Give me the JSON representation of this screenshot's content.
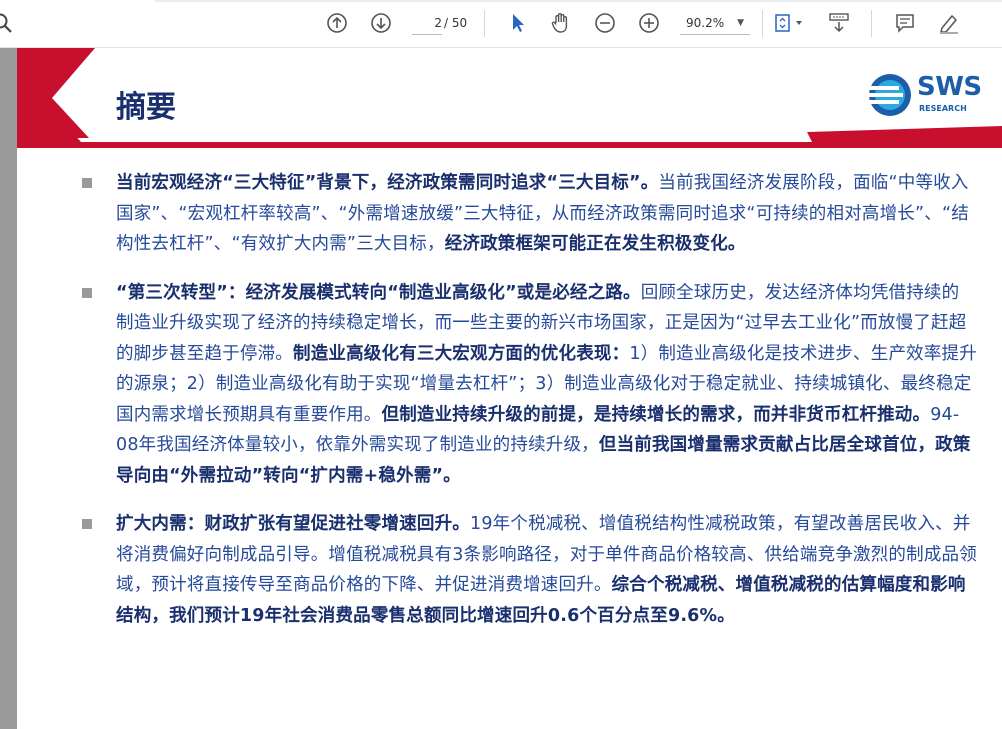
{
  "toolbar": {
    "page_current": "2",
    "page_total": "/ 50",
    "zoom": "90.2%",
    "icons": [
      "search-icon",
      "page-up-icon",
      "page-down-icon",
      "select-cursor-icon",
      "hand-tool-icon",
      "zoom-out-icon",
      "zoom-in-icon",
      "fit-page-icon",
      "scroll-mode-icon",
      "comment-icon",
      "highlight-pen-icon"
    ]
  },
  "document": {
    "title": "摘要",
    "logo_text": "SWS",
    "logo_subtext": "RESEARCH",
    "colors": {
      "accent_red": "#c8102e",
      "navy": "#1a2f6e",
      "body_blue": "#264a9a",
      "logo_blue": "#1c5fa8"
    },
    "paragraphs": [
      {
        "segments": [
          {
            "bold": true,
            "text": "当前宏观经济“三大特征”背景下，经济政策需同时追求“三大目标”。"
          },
          {
            "bold": false,
            "text": "当前我国经济发展阶段，面临“中等收入国家”、“宏观杠杆率较高”、“外需增速放缓”三大特征，从而经济政策需同时追求“可持续的相对高增长”、“结构性去杠杆”、“有效扩大内需”三大目标，"
          },
          {
            "bold": true,
            "text": "经济政策框架可能正在发生积极变化。"
          }
        ]
      },
      {
        "segments": [
          {
            "bold": true,
            "text": "“第三次转型”：经济发展模式转向“制造业高级化”或是必经之路。"
          },
          {
            "bold": false,
            "text": "回顾全球历史，发达经济体均凭借持续的制造业升级实现了经济的持续稳定增长，而一些主要的新兴市场国家，正是因为“过早去工业化”而放慢了赶超的脚步甚至趋于停滞。"
          },
          {
            "bold": true,
            "text": "制造业高级化有三大宏观方面的优化表现："
          },
          {
            "bold": false,
            "text": "1）制造业高级化是技术进步、生产效率提升的源泉；2）制造业高级化有助于实现“增量去杠杆”；3）制造业高级化对于稳定就业、持续城镇化、最终稳定国内需求增长预期具有重要作用。"
          },
          {
            "bold": true,
            "text": "但制造业持续升级的前提，是持续增长的需求，而并非货币杠杆推动。"
          },
          {
            "bold": false,
            "text": "94-08年我国经济体量较小，依靠外需实现了制造业的持续升级，"
          },
          {
            "bold": true,
            "text": "但当前我国增量需求贡献占比居全球首位，政策导向由“外需拉动”转向“扩内需+稳外需”。"
          }
        ]
      },
      {
        "segments": [
          {
            "bold": true,
            "text": "扩大内需：财政扩张有望促进社零增速回升。"
          },
          {
            "bold": false,
            "text": "19年个税减税、增值税结构性减税政策，有望改善居民收入、并将消费偏好向制成品引导。增值税减税具有3条影响路径，对于单件商品价格较高、供给端竞争激烈的制成品领域，预计将直接传导至商品价格的下降、并促进消费增速回升。"
          },
          {
            "bold": true,
            "text": "综合个税减税、增值税减税的估算幅度和影响结构，我们预计19年社会消费品零售总额同比增速回升0.6个百分点至9.6%。"
          }
        ]
      }
    ]
  }
}
